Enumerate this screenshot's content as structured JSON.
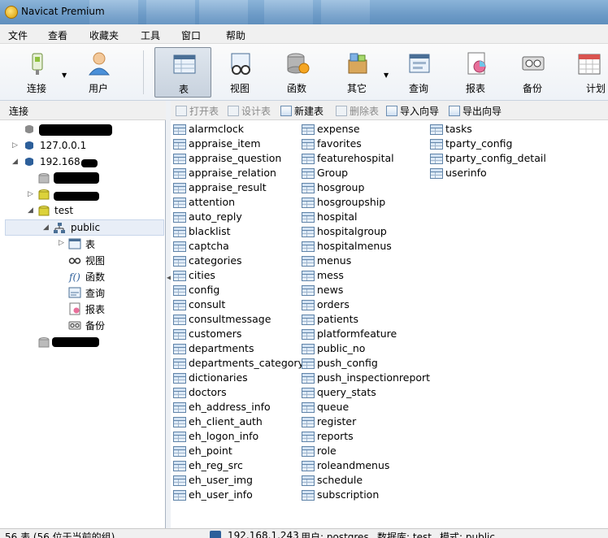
{
  "window": {
    "title": "Navicat Premium"
  },
  "menu": {
    "items": [
      "文件",
      "查看",
      "收藏夹",
      "工具",
      "窗口",
      "帮助"
    ]
  },
  "toolbar": {
    "buttons": [
      {
        "label": "连接",
        "icon": "plug-icon"
      },
      {
        "label": "用户",
        "icon": "user-icon"
      },
      {
        "label": "表",
        "icon": "table-icon"
      },
      {
        "label": "视图",
        "icon": "view-glasses-icon"
      },
      {
        "label": "函数",
        "icon": "function-icon"
      },
      {
        "label": "其它",
        "icon": "other-objects-icon"
      },
      {
        "label": "查询",
        "icon": "query-icon"
      },
      {
        "label": "报表",
        "icon": "report-icon"
      },
      {
        "label": "备份",
        "icon": "backup-icon"
      },
      {
        "label": "计划",
        "icon": "schedule-calendar-icon"
      }
    ]
  },
  "left_pane": {
    "header": "连接",
    "tree": {
      "conn1": "127.0.0.1",
      "conn2": "192.168.",
      "db_test": "test",
      "schema_public": "public",
      "items": [
        "表",
        "视图",
        "函数",
        "查询",
        "报表",
        "备份"
      ]
    }
  },
  "object_toolbar": {
    "open": "打开表",
    "design": "设计表",
    "new": "新建表",
    "delete": "删除表",
    "import": "导入向导",
    "export": "导出向导"
  },
  "tables": {
    "col1": [
      "alarmclock",
      "appraise_item",
      "appraise_question",
      "appraise_relation",
      "appraise_result",
      "attention",
      "auto_reply",
      "blacklist",
      "captcha",
      "categories",
      "cities",
      "config",
      "consult",
      "consultmessage",
      "customers",
      "departments",
      "departments_category",
      "dictionaries",
      "doctors",
      "eh_address_info",
      "eh_client_auth",
      "eh_logon_info",
      "eh_point",
      "eh_reg_src",
      "eh_user_img",
      "eh_user_info"
    ],
    "col2": [
      "expense",
      "favorites",
      "featurehospital",
      "Group",
      "hosgroup",
      "hosgroupship",
      "hospital",
      "hospitalgroup",
      "hospitalmenus",
      "menus",
      "mess",
      "news",
      "orders",
      "patients",
      "platformfeature",
      "public_no",
      "push_config",
      "push_inspectionreport",
      "query_stats",
      "queue",
      "register",
      "reports",
      "role",
      "roleandmenus",
      "schedule",
      "subscription"
    ],
    "col3": [
      "tasks",
      "tparty_config",
      "tparty_config_detail",
      "userinfo"
    ]
  },
  "status": {
    "count": "56 表 (56 位于当前的组)",
    "connection": "192.168.1.243",
    "user": "用户: postgres",
    "database": "数据库: test",
    "schema": "模式: public"
  },
  "colors": {
    "selected_button": "#c8d2de",
    "title_bar": "#6d9bc7",
    "icon_blue": "#5f83a8"
  }
}
